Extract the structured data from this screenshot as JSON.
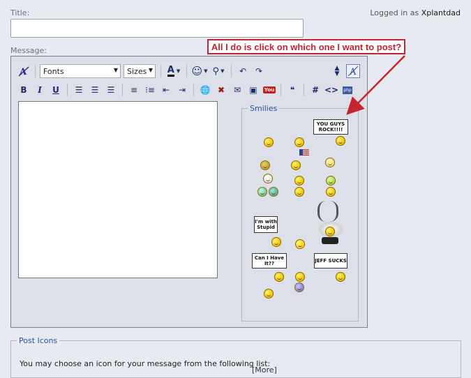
{
  "labels": {
    "title": "Title:",
    "message": "Message:"
  },
  "session": {
    "logged_in_prefix": "Logged in as",
    "username": "Xplantdad"
  },
  "toolbar": {
    "fonts": "Fonts",
    "sizes": "Sizes",
    "color_letter": "A",
    "bold": "B",
    "italic": "I",
    "underline": "U",
    "hash": "#",
    "code": "<>",
    "php": "php",
    "youtube": "You"
  },
  "smilies": {
    "legend": "Smilies",
    "more": "[More]",
    "signs": {
      "you_guys_rock": "YOU GUYS ROCK!!!!",
      "with_stupid": "I'm with Stupid",
      "can_i_have_it": "Can I Have It??",
      "jeff_sucks": "JEFF SUCKS"
    }
  },
  "annotation": {
    "text": "All I do is click on which one I want to post?",
    "color": "#c62430"
  },
  "post_icons": {
    "legend": "Post Icons",
    "description": "You may choose an icon for your message from the following list:"
  }
}
